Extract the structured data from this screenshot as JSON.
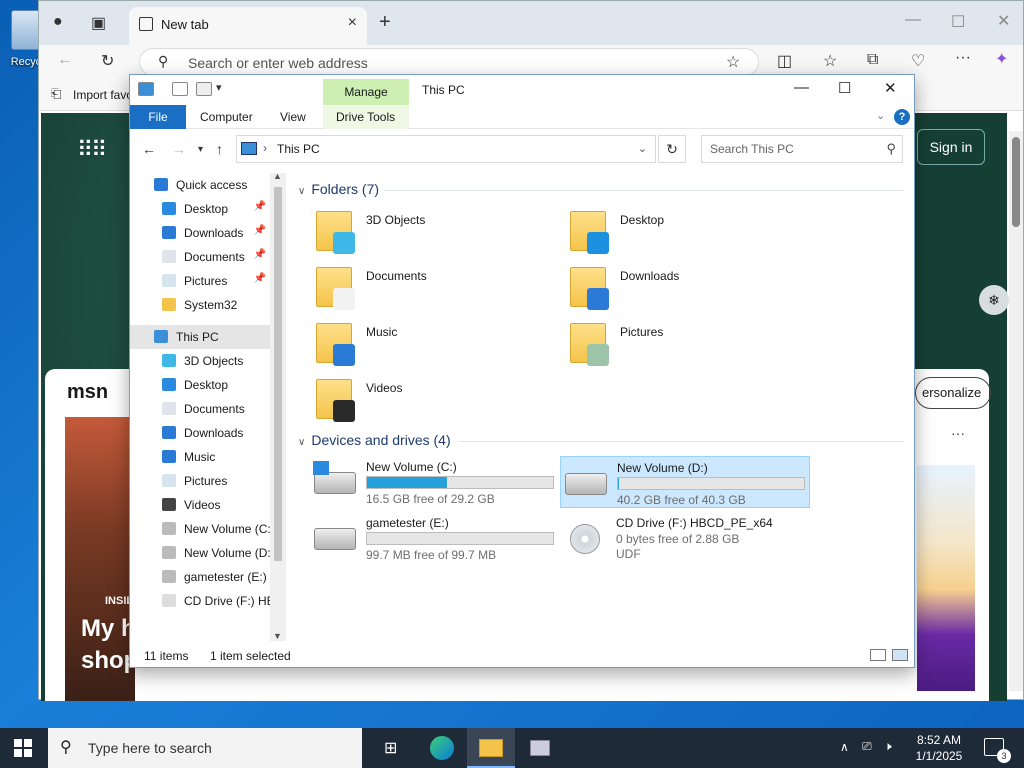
{
  "desktop": {
    "recycle_label": "Recyc"
  },
  "edge": {
    "tab_title": "New tab",
    "address_placeholder": "Search or enter web address",
    "favorites_import": "Import favo",
    "signin": "Sign in",
    "msn": "msn",
    "personalize": "ersonalize",
    "story_kicker": "INSIL",
    "story_title_1": "My h",
    "story_title_2": "shop"
  },
  "explorer": {
    "window_title": "This PC",
    "manage_tab": "Manage",
    "ribbon": {
      "file": "File",
      "computer": "Computer",
      "view": "View",
      "drive_tools": "Drive Tools"
    },
    "address": "This PC",
    "search_placeholder": "Search This PC",
    "sidebar": [
      {
        "label": "Quick access",
        "icon": "star-icon"
      },
      {
        "label": "Desktop",
        "icon": "desktop-folder-icon",
        "pinned": true
      },
      {
        "label": "Downloads",
        "icon": "downloads-icon",
        "pinned": true
      },
      {
        "label": "Documents",
        "icon": "documents-icon",
        "pinned": true
      },
      {
        "label": "Pictures",
        "icon": "pictures-icon",
        "pinned": true
      },
      {
        "label": "System32",
        "icon": "folder-icon"
      },
      {
        "label": "This PC",
        "icon": "this-pc-icon",
        "selected": true
      },
      {
        "label": "3D Objects",
        "icon": "3d-objects-icon"
      },
      {
        "label": "Desktop",
        "icon": "desktop-folder-icon"
      },
      {
        "label": "Documents",
        "icon": "documents-icon"
      },
      {
        "label": "Downloads",
        "icon": "downloads-icon"
      },
      {
        "label": "Music",
        "icon": "music-icon"
      },
      {
        "label": "Pictures",
        "icon": "pictures-icon"
      },
      {
        "label": "Videos",
        "icon": "videos-icon"
      },
      {
        "label": "New Volume (C:",
        "icon": "drive-icon"
      },
      {
        "label": "New Volume (D:",
        "icon": "drive-icon"
      },
      {
        "label": "gametester (E:)",
        "icon": "drive-icon"
      },
      {
        "label": "CD Drive (F:) HB",
        "icon": "cd-drive-icon"
      }
    ],
    "folders_header": "Folders (7)",
    "folders": [
      {
        "name": "3D Objects",
        "icon": "3d-objects-icon"
      },
      {
        "name": "Desktop",
        "icon": "desktop-folder-icon"
      },
      {
        "name": "Documents",
        "icon": "documents-icon"
      },
      {
        "name": "Downloads",
        "icon": "downloads-icon"
      },
      {
        "name": "Music",
        "icon": "music-icon"
      },
      {
        "name": "Pictures",
        "icon": "pictures-icon"
      },
      {
        "name": "Videos",
        "icon": "videos-icon"
      }
    ],
    "drives_header": "Devices and drives (4)",
    "drives": [
      {
        "name": "New Volume (C:)",
        "free": "16.5 GB free of 29.2 GB",
        "used_fraction": 0.43,
        "icon": "windows-drive-icon"
      },
      {
        "name": "New Volume (D:)",
        "free": "40.2 GB free of 40.3 GB",
        "used_fraction": 0.003,
        "icon": "drive-icon",
        "selected": true
      },
      {
        "name": "gametester (E:)",
        "free": "99.7 MB free of 99.7 MB",
        "used_fraction": 0.0,
        "icon": "drive-icon"
      },
      {
        "name": "CD Drive (F:) HBCD_PE_x64",
        "free": "0 bytes free of 2.88 GB",
        "filesystem": "UDF",
        "icon": "cd-drive-icon"
      }
    ],
    "status_items": "11 items",
    "status_selected": "1 item selected"
  },
  "taskbar": {
    "search_placeholder": "Type here to search",
    "time": "8:52 AM",
    "date": "1/1/2025",
    "notification_count": "3"
  },
  "colors": {
    "accent": "#1a6fc4",
    "manage_green": "#cdefb1",
    "selection": "#cce8ff",
    "drive_fill": "#26a0da",
    "taskbar": "#1f2a38"
  }
}
